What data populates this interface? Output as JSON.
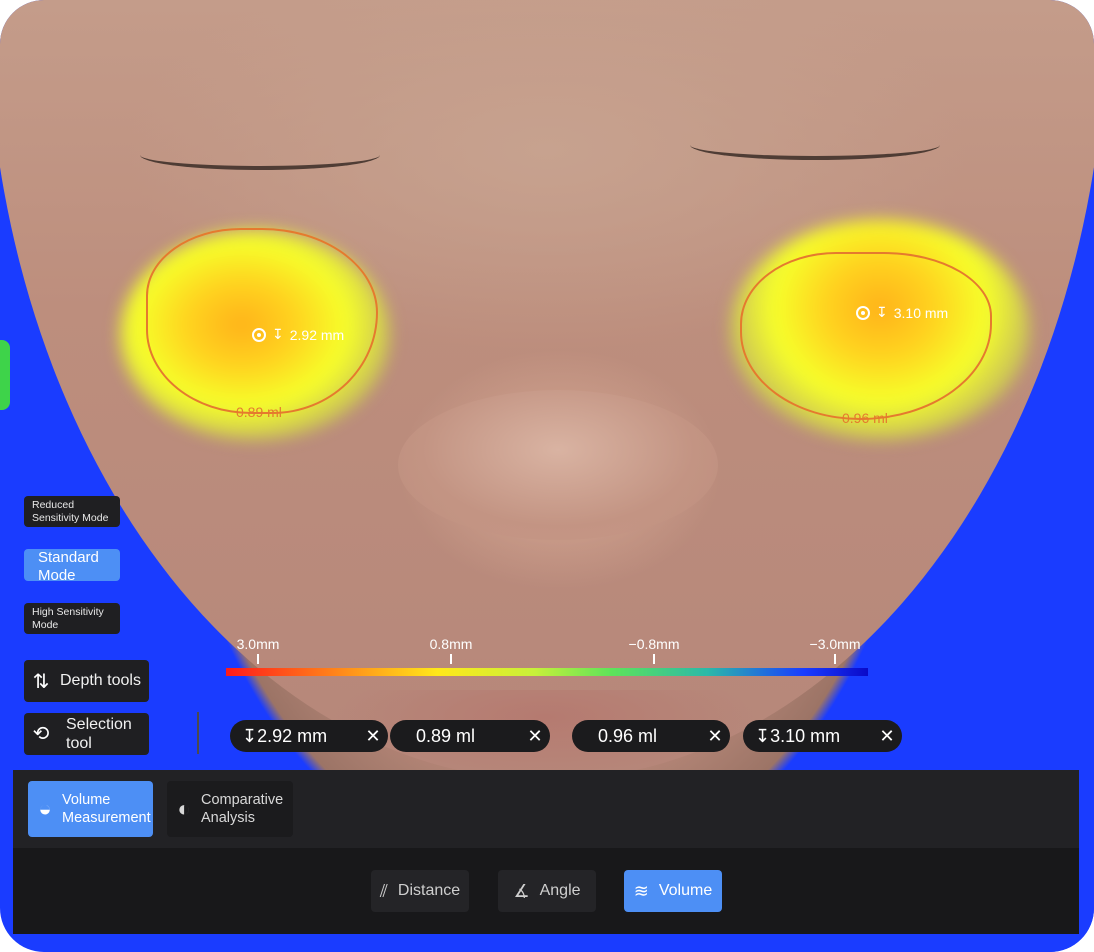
{
  "left_region": {
    "depth": "2.92 mm",
    "volume": "0.89 ml"
  },
  "right_region": {
    "depth": "3.10 mm",
    "volume": "0.96 ml"
  },
  "modes": [
    {
      "label": "Reduced Sensitivity Mode",
      "active": false
    },
    {
      "label": "Standard Mode",
      "active": true
    },
    {
      "label": "High Sensitivity Mode",
      "active": false
    }
  ],
  "tools": {
    "depth": "Depth tools",
    "selection": "Selection tool"
  },
  "scale": {
    "labels": [
      "3.0mm",
      "0.8mm",
      "−0.8mm",
      "−3.0mm"
    ]
  },
  "chips": [
    {
      "text": "↧2.92 mm",
      "close": "✕"
    },
    {
      "text": "0.89 ml",
      "close": "✕"
    },
    {
      "text": "0.96 ml",
      "close": "✕"
    },
    {
      "text": "↧3.10 mm",
      "close": "✕"
    }
  ],
  "analysis": {
    "volume_measurement": "Volume Measurement",
    "comparative_analysis": "Comparative Analysis"
  },
  "measure_tabs": {
    "distance": "Distance",
    "angle": "Angle",
    "volume": "Volume"
  },
  "icons": {
    "depth": "depth-tool-icon",
    "selection": "selection-loop-icon",
    "volume": "volume-icon",
    "compare": "compare-icon",
    "distance": "ruler-icon",
    "angle": "angle-icon",
    "volume_tab": "wave-lines-icon"
  },
  "colors": {
    "accent": "#4d8ff5",
    "outline": "#e57a2e",
    "panel": "#222225"
  }
}
